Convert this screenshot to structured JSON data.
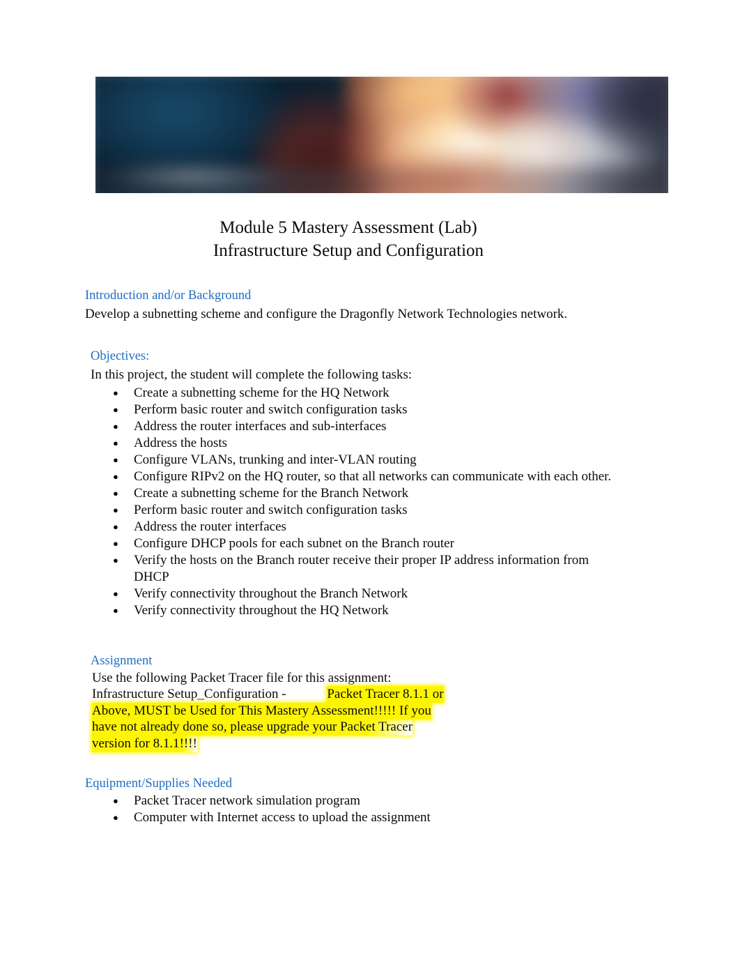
{
  "document": {
    "title_line_1": "Module 5 Mastery Assessment (Lab)",
    "title_line_2": "Infrastructure Setup and Configuration"
  },
  "banner": {
    "alt": "blurred decorative cybersecurity photo banner",
    "colors": {
      "navy": "#123a55",
      "warm_glow": "#f5e2cf",
      "maroon": "#801f24",
      "violet": "#5c5696"
    }
  },
  "theme": {
    "heading_color": "#1f6fc4",
    "body_color": "#0b0b0b",
    "highlight_color": "#fdf500",
    "page_background": "#ffffff"
  },
  "sections": {
    "introduction": {
      "heading": "Introduction and/or Background",
      "body": "Develop a subnetting scheme and configure the Dragonfly Network Technologies network."
    },
    "objectives": {
      "heading": "Objectives:",
      "intro": "In this project, the student will complete the following tasks:",
      "items": [
        "Create a subnetting scheme for the HQ Network",
        "Perform basic router and switch configuration tasks",
        "Address the router interfaces and sub-interfaces",
        "Address the hosts",
        "Configure VLANs, trunking and inter-VLAN routing",
        "Configure RIPv2 on the HQ router, so that all networks can communicate with each other.",
        "Create a subnetting scheme for the Branch Network",
        "Perform basic router and switch configuration tasks",
        "Address the router interfaces",
        "Configure DHCP pools for each subnet on the Branch router",
        "Verify the hosts on the Branch router receive their proper IP address information from DHCP",
        "Verify connectivity throughout the Branch Network",
        "Verify connectivity throughout the HQ Network"
      ]
    },
    "assignment": {
      "heading": "Assignment",
      "line_1": "Use the following Packet Tracer file for this assignment:",
      "line_2_plain": "Infrastructure Setup_Configuration - ",
      "line_2_highlight": "Packet Tracer 8.1.1 or",
      "line_3_highlight": "Above, MUST be Used for This Mastery Assessment!!!!! If you",
      "line_4_highlight": "have not already done so, please upgrade your Packet Tracer",
      "line_5_highlight": "version for 8.1.1!!!!"
    },
    "equipment": {
      "heading": "Equipment/Supplies Needed",
      "items": [
        "Packet Tracer network simulation program",
        "Computer with Internet access to upload the assignment"
      ]
    }
  }
}
